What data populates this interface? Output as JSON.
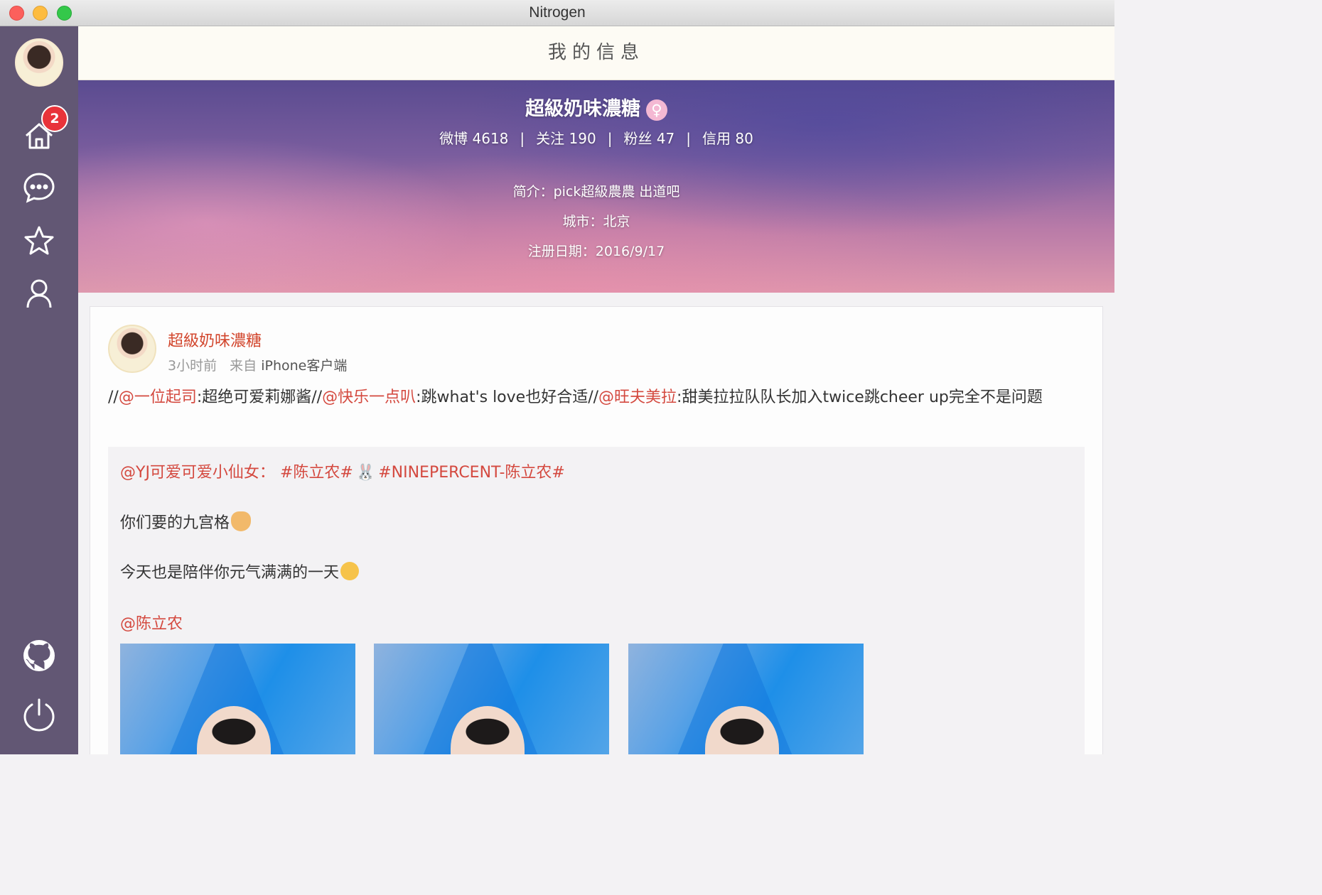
{
  "window": {
    "title": "Nitrogen"
  },
  "sidebar": {
    "notification_count": "2",
    "items": [
      "home-icon",
      "chat-icon",
      "star-icon",
      "user-icon"
    ],
    "bottom_items": [
      "github-icon",
      "power-icon"
    ]
  },
  "header": {
    "title": "我的信息"
  },
  "profile": {
    "name": "超級奶味濃糖",
    "gender_symbol": "♀",
    "stats": {
      "weibo": "微博 4618",
      "following": "关注 190",
      "followers": "粉丝 47",
      "credit": "信用 80",
      "separator": "|"
    },
    "bio": "简介：pick超級農農 出道吧",
    "city": "城市：北京",
    "register_date": "注册日期：2016/9/17"
  },
  "post": {
    "author": "超級奶味濃糖",
    "time": "3小时前",
    "source_prefix": "来自",
    "source": "iPhone客户端",
    "text_segments": [
      {
        "text": "//",
        "mention": false
      },
      {
        "text": "@一位起司",
        "mention": true
      },
      {
        "text": ":超绝可爱莉娜酱//",
        "mention": false
      },
      {
        "text": "@快乐一点叭",
        "mention": true
      },
      {
        "text": ":跳what's love也好合适//",
        "mention": false
      },
      {
        "text": "@旺夫美拉",
        "mention": true
      },
      {
        "text": ":甜美拉拉队队长加入twice跳cheer up完全不是问题",
        "mention": false
      }
    ],
    "repost": {
      "line1_author": "@YJ可爱可爱小仙女：",
      "line1_tag1": "#陈立农#",
      "line1_tag2": "#NINEPERCENT-陈立农#",
      "line2": "你们要的九宫格",
      "line3": "今天也是陪伴你元气满满的一天",
      "line4": "@陈立农"
    }
  },
  "colors": {
    "sidebar": "#625774",
    "mention": "#d4493f",
    "badge": "#e8333a"
  }
}
